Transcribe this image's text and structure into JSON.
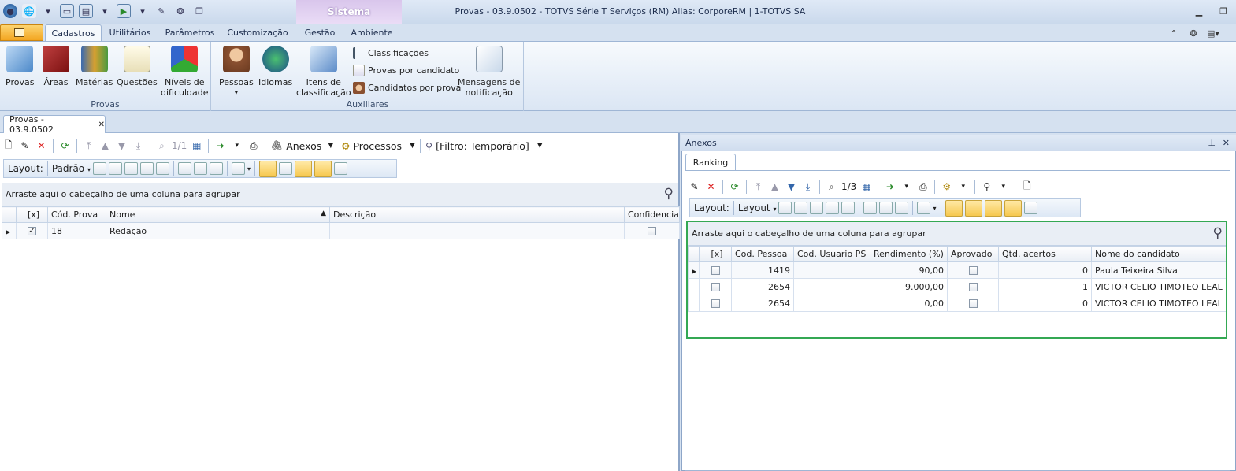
{
  "window": {
    "title": "Provas - 03.9.0502 - TOTVS Série T Serviços (RM) Alias: CorporeRM | 1-TOTVS SA",
    "context_tab": "Sistema"
  },
  "ribbon": {
    "tabs": [
      "Cadastros",
      "Utilitários",
      "Parâmetros",
      "Customização",
      "Gestão",
      "Ambiente"
    ],
    "active_tab": "Cadastros",
    "groups": {
      "provas": {
        "label": "Provas",
        "buttons": [
          "Provas",
          "Áreas",
          "Matérias",
          "Questões",
          "Níveis de",
          "dificuldade"
        ]
      },
      "auxiliares": {
        "label": "Auxiliares",
        "buttons": [
          "Pessoas",
          "Idiomas",
          "Itens de",
          "classificação",
          "Mensagens de",
          "notificação"
        ],
        "small": [
          "Classificações",
          "Provas por candidato",
          "Candidatos por prova"
        ]
      }
    }
  },
  "doc_tab": {
    "label": "Provas - 03.9.0502",
    "close": "✕"
  },
  "left": {
    "toolbar": {
      "pager": "1/1",
      "anexos": "Anexos",
      "processos": "Processos",
      "filtro": "[Filtro: Temporário]"
    },
    "layout_bar": {
      "layout": "Layout:",
      "padrao": "Padrão"
    },
    "group_hint": "Arraste aqui o cabeçalho de uma coluna para agrupar",
    "columns": [
      "[x]",
      "Cód. Prova",
      "Nome",
      "Descrição",
      "Confidencial"
    ],
    "rows": [
      {
        "checked": true,
        "cod": "18",
        "nome": "Redação",
        "descricao": "",
        "confidencial": false
      }
    ]
  },
  "right": {
    "panel_title": "Anexos",
    "tab": "Ranking",
    "toolbar": {
      "pager": "1/3"
    },
    "layout_bar": {
      "layout": "Layout:",
      "layout_btn": "Layout"
    },
    "group_hint": "Arraste aqui o cabeçalho de uma coluna para agrupar",
    "columns": [
      "[x]",
      "Cod. Pessoa",
      "Cod. Usuario PS",
      "Rendimento (%)",
      "Aprovado",
      "Qtd. acertos",
      "Nome do candidato"
    ],
    "rows": [
      {
        "pessoa": "1419",
        "usuario": "",
        "rendimento": "90,00",
        "acertos": "0",
        "nome": "Paula Teixeira Silva"
      },
      {
        "pessoa": "2654",
        "usuario": "",
        "rendimento": "9.000,00",
        "acertos": "1",
        "nome": "VICTOR CELIO TIMOTEO LEAL"
      },
      {
        "pessoa": "2654",
        "usuario": "",
        "rendimento": "0,00",
        "acertos": "0",
        "nome": "VICTOR CELIO TIMOTEO LEAL"
      }
    ]
  },
  "colors": {
    "highlight_border": "#34a853",
    "accent": "#f3a520"
  }
}
